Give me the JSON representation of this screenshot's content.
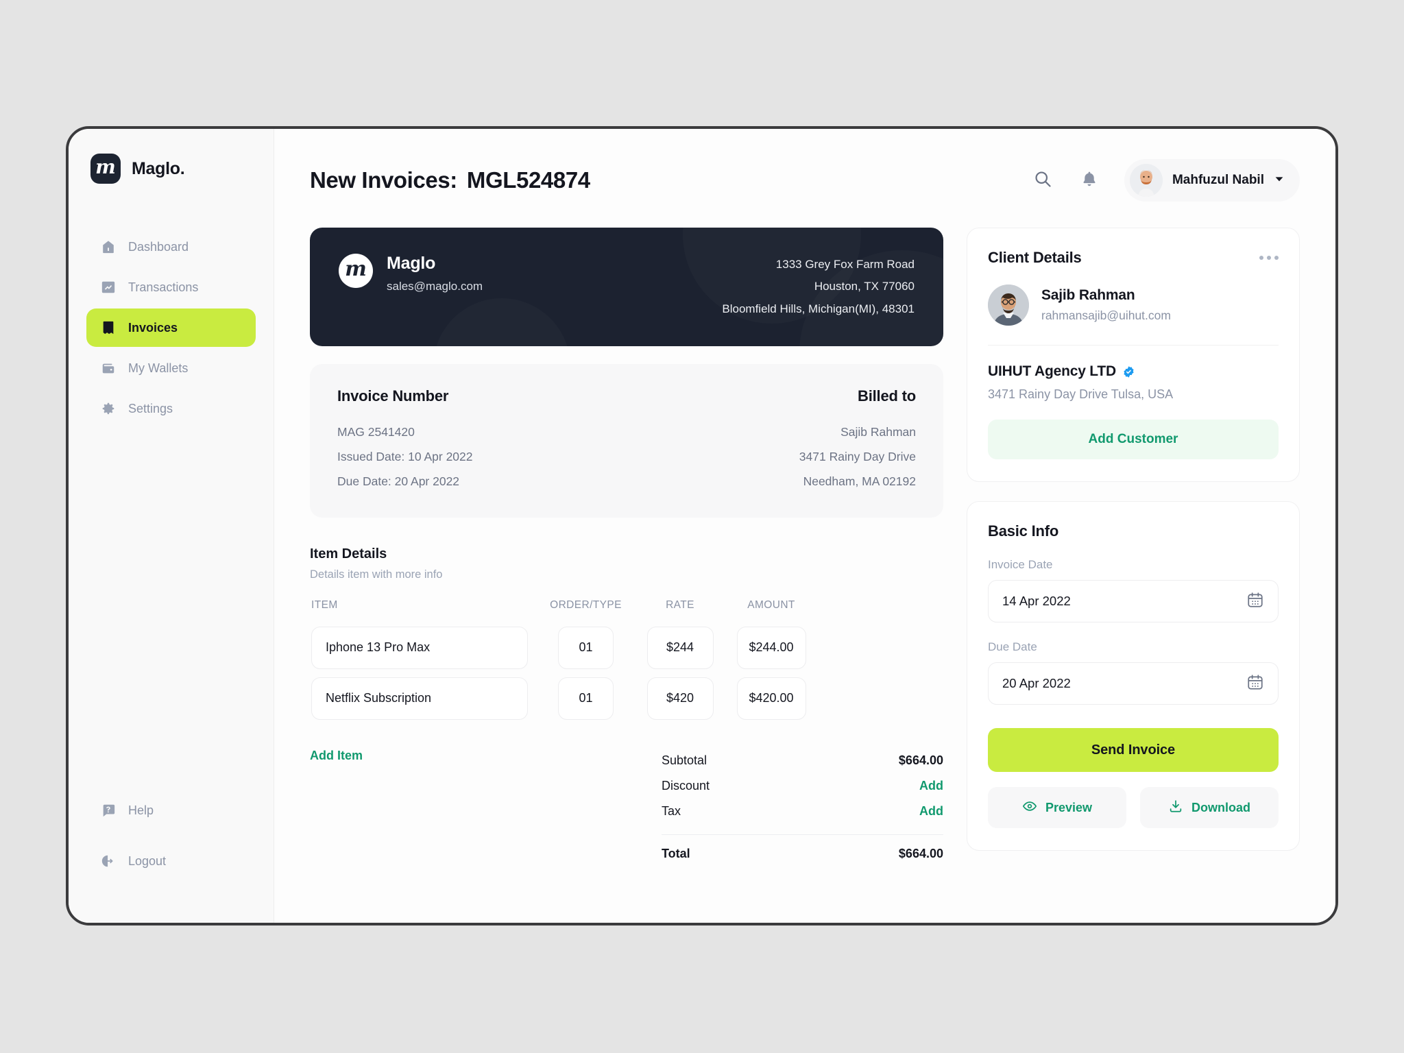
{
  "theme": {
    "accent_lime": "#C9EB40",
    "accent_green": "#11996E",
    "dark_navy": "#1C2230",
    "canvas_bg": "#E4E4E4",
    "verified_blue": "#1D9BF0"
  },
  "sidebar": {
    "brand": {
      "mark": "m",
      "name": "Maglo."
    },
    "items": [
      {
        "label": "Dashboard",
        "icon": "home-icon",
        "active": false
      },
      {
        "label": "Transactions",
        "icon": "transactions-icon",
        "active": false
      },
      {
        "label": "Invoices",
        "icon": "invoice-icon",
        "active": true
      },
      {
        "label": "My Wallets",
        "icon": "wallet-icon",
        "active": false
      },
      {
        "label": "Settings",
        "icon": "gear-icon",
        "active": false
      }
    ],
    "bottom_items": [
      {
        "label": "Help",
        "icon": "help-icon"
      },
      {
        "label": "Logout",
        "icon": "logout-icon"
      }
    ]
  },
  "topbar": {
    "title_prefix": "New Invoices:",
    "invoice_id": "MGL524874",
    "search_icon": "search-icon",
    "bell_icon": "bell-icon",
    "user_name": "Mahfuzul Nabil",
    "chevron_icon": "chevron-down-icon"
  },
  "invoice_header": {
    "logo": "m",
    "company": "Maglo",
    "email": "sales@maglo.com",
    "address_lines": [
      "1333 Grey Fox Farm Road",
      "Houston, TX 77060",
      "Bloomfield Hills, Michigan(MI), 48301"
    ]
  },
  "invoice_meta": {
    "left_title": "Invoice Number",
    "right_title": "Billed to",
    "left_lines": [
      "MAG 2541420",
      "Issued Date: 10 Apr 2022",
      "Due Date: 20 Apr 2022"
    ],
    "right_lines": [
      "Sajib Rahman",
      "3471 Rainy Day Drive",
      "Needham, MA 02192"
    ]
  },
  "item_details": {
    "title": "Item Details",
    "subtitle": "Details item with more info",
    "columns": [
      "ITEM",
      "ORDER/TYPE",
      "RATE",
      "AMOUNT"
    ],
    "rows": [
      {
        "item": "Iphone 13 Pro Max",
        "qty": "01",
        "rate": "$244",
        "amount": "$244.00"
      },
      {
        "item": "Netflix Subscription",
        "qty": "01",
        "rate": "$420",
        "amount": "$420.00"
      }
    ],
    "add_item_label": "Add Item",
    "totals": [
      {
        "label": "Subtotal",
        "value": "$664.00",
        "is_link": false
      },
      {
        "label": "Discount",
        "value": "Add",
        "is_link": true
      },
      {
        "label": "Tax",
        "value": "Add",
        "is_link": true
      }
    ],
    "total_label": "Total",
    "total_value": "$664.00"
  },
  "client_details": {
    "title": "Client Details",
    "menu_icon": "more-options-icon",
    "name": "Sajib Rahman",
    "email": "rahmansajib@uihut.com",
    "agency_name": "UIHUT Agency LTD",
    "verified_icon": "verified-badge-icon",
    "agency_address": "3471 Rainy Day Drive Tulsa, USA",
    "add_customer_label": "Add Customer"
  },
  "basic_info": {
    "title": "Basic Info",
    "invoice_date_label": "Invoice Date",
    "invoice_date_value": "14 Apr 2022",
    "due_date_label": "Due Date",
    "due_date_value": "20 Apr 2022",
    "calendar_icon": "calendar-icon",
    "send_label": "Send Invoice",
    "preview_label": "Preview",
    "preview_icon": "eye-icon",
    "download_label": "Download",
    "download_icon": "download-icon"
  }
}
